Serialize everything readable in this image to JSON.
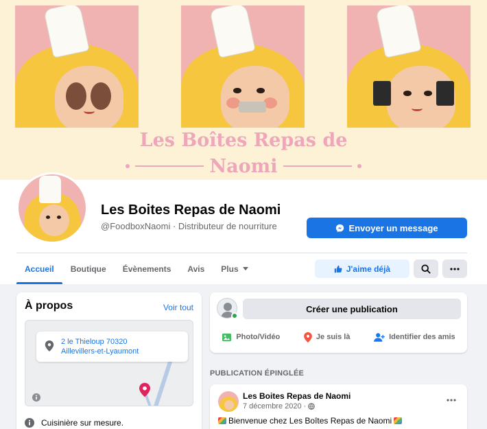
{
  "cover": {
    "title": "Les Boîtes Repas de",
    "subtitle": "Naomi"
  },
  "page": {
    "name": "Les Boites Repas de Naomi",
    "handle_meta": "@FoodboxNaomi · Distributeur de nourriture",
    "message_button": "Envoyer un message"
  },
  "tabs": [
    {
      "label": "Accueil",
      "active": true
    },
    {
      "label": "Boutique"
    },
    {
      "label": "Évènements"
    },
    {
      "label": "Avis"
    },
    {
      "label": "Plus"
    }
  ],
  "actions": {
    "like_button": "J'aime déjà",
    "search_icon": "search-icon",
    "more_icon": "more-dots-icon"
  },
  "about": {
    "title": "À propos",
    "see_all": "Voir tout",
    "address_line1": "2 le Thieloup 70320",
    "address_line2": "Aillevillers-et-Lyaumont",
    "info_row": "Cuisinière sur mesure."
  },
  "composer": {
    "create_post": "Créer une publication",
    "photo_video": "Photo/Vidéo",
    "feeling": "Je suis là",
    "tag_friends": "Identifier des amis"
  },
  "pinned": {
    "section_label": "PUBLICATION ÉPINGLÉE",
    "author": "Les Boites Repas de Naomi",
    "date": "7 décembre 2020 ·",
    "text": "Bienvenue chez Les Boîtes Repas de Naomi"
  },
  "colors": {
    "brand_blue": "#1b74e4",
    "cover_pink_text": "#eea6bb",
    "background": "#f0f2f5"
  }
}
